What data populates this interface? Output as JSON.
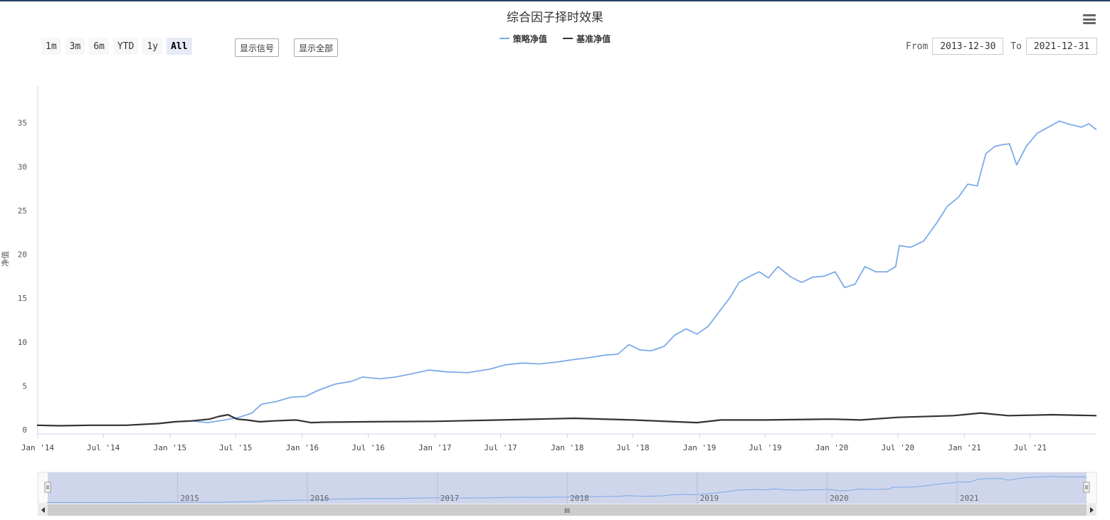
{
  "chart_data": {
    "type": "line",
    "title": "综合因子择时效果",
    "ylabel": "净值",
    "xlabel": "",
    "ylim": [
      0,
      40
    ],
    "yticks": [
      0,
      5,
      10,
      15,
      20,
      25,
      30,
      35
    ],
    "xlim": [
      "2014-01-01",
      "2021-12-31"
    ],
    "xticks": [
      {
        "date": "2014-01-01",
        "label": "Jan '14"
      },
      {
        "date": "2014-07-01",
        "label": "Jul '14"
      },
      {
        "date": "2015-01-01",
        "label": "Jan '15"
      },
      {
        "date": "2015-07-01",
        "label": "Jul '15"
      },
      {
        "date": "2016-01-01",
        "label": "Jan '16"
      },
      {
        "date": "2016-07-01",
        "label": "Jul '16"
      },
      {
        "date": "2017-01-01",
        "label": "Jan '17"
      },
      {
        "date": "2017-07-01",
        "label": "Jul '17"
      },
      {
        "date": "2018-01-01",
        "label": "Jan '18"
      },
      {
        "date": "2018-07-01",
        "label": "Jul '18"
      },
      {
        "date": "2019-01-01",
        "label": "Jan '19"
      },
      {
        "date": "2019-07-01",
        "label": "Jul '19"
      },
      {
        "date": "2020-01-01",
        "label": "Jan '20"
      },
      {
        "date": "2020-07-01",
        "label": "Jul '20"
      },
      {
        "date": "2021-01-01",
        "label": "Jan '21"
      },
      {
        "date": "2021-07-01",
        "label": "Jul '21"
      }
    ],
    "legend_position": "top-center",
    "grid": false,
    "series": [
      {
        "name": "策略净值",
        "color": "#7cabe8",
        "points": [
          [
            "2013-12-30",
            0.5
          ],
          [
            "2014-03-01",
            0.45
          ],
          [
            "2014-06-01",
            0.5
          ],
          [
            "2014-09-01",
            0.5
          ],
          [
            "2014-12-01",
            0.7
          ],
          [
            "2015-01-15",
            0.9
          ],
          [
            "2015-03-01",
            1.0
          ],
          [
            "2015-04-15",
            0.8
          ],
          [
            "2015-06-01",
            1.1
          ],
          [
            "2015-07-10",
            1.4
          ],
          [
            "2015-08-15",
            1.9
          ],
          [
            "2015-09-10",
            2.9
          ],
          [
            "2015-10-20",
            3.2
          ],
          [
            "2015-12-01",
            3.7
          ],
          [
            "2016-01-10",
            3.8
          ],
          [
            "2016-02-15",
            4.5
          ],
          [
            "2016-04-01",
            5.2
          ],
          [
            "2016-05-15",
            5.5
          ],
          [
            "2016-06-15",
            6.0
          ],
          [
            "2016-08-01",
            5.8
          ],
          [
            "2016-09-15",
            6.0
          ],
          [
            "2016-11-01",
            6.4
          ],
          [
            "2016-12-15",
            6.8
          ],
          [
            "2017-02-01",
            6.6
          ],
          [
            "2017-04-01",
            6.5
          ],
          [
            "2017-06-01",
            6.9
          ],
          [
            "2017-07-15",
            7.4
          ],
          [
            "2017-09-01",
            7.6
          ],
          [
            "2017-10-15",
            7.5
          ],
          [
            "2017-12-01",
            7.7
          ],
          [
            "2018-01-20",
            8.0
          ],
          [
            "2018-03-01",
            8.2
          ],
          [
            "2018-04-15",
            8.5
          ],
          [
            "2018-05-20",
            8.6
          ],
          [
            "2018-06-20",
            9.7
          ],
          [
            "2018-07-20",
            9.1
          ],
          [
            "2018-08-20",
            9.0
          ],
          [
            "2018-09-25",
            9.5
          ],
          [
            "2018-10-25",
            10.8
          ],
          [
            "2018-11-25",
            11.5
          ],
          [
            "2018-12-25",
            10.9
          ],
          [
            "2019-01-25",
            11.8
          ],
          [
            "2019-02-25",
            13.5
          ],
          [
            "2019-03-25",
            15.0
          ],
          [
            "2019-04-20",
            16.8
          ],
          [
            "2019-05-20",
            17.5
          ],
          [
            "2019-06-15",
            18.0
          ],
          [
            "2019-07-10",
            17.3
          ],
          [
            "2019-08-05",
            18.6
          ],
          [
            "2019-09-10",
            17.4
          ],
          [
            "2019-10-10",
            16.8
          ],
          [
            "2019-11-10",
            17.4
          ],
          [
            "2019-12-10",
            17.5
          ],
          [
            "2020-01-10",
            18.0
          ],
          [
            "2020-02-05",
            16.2
          ],
          [
            "2020-03-05",
            16.6
          ],
          [
            "2020-04-01",
            18.6
          ],
          [
            "2020-05-01",
            18.0
          ],
          [
            "2020-06-01",
            18.0
          ],
          [
            "2020-06-25",
            18.6
          ],
          [
            "2020-07-05",
            21.0
          ],
          [
            "2020-08-05",
            20.8
          ],
          [
            "2020-09-10",
            21.5
          ],
          [
            "2020-10-15",
            23.5
          ],
          [
            "2020-11-15",
            25.5
          ],
          [
            "2020-12-15",
            26.5
          ],
          [
            "2021-01-10",
            28.0
          ],
          [
            "2021-02-05",
            27.8
          ],
          [
            "2021-03-01",
            31.5
          ],
          [
            "2021-03-25",
            32.3
          ],
          [
            "2021-04-15",
            32.5
          ],
          [
            "2021-05-05",
            32.6
          ],
          [
            "2021-05-25",
            30.2
          ],
          [
            "2021-06-20",
            32.3
          ],
          [
            "2021-07-20",
            33.8
          ],
          [
            "2021-08-20",
            34.5
          ],
          [
            "2021-09-20",
            35.2
          ],
          [
            "2021-10-20",
            34.8
          ],
          [
            "2021-11-20",
            34.5
          ],
          [
            "2021-12-10",
            34.9
          ],
          [
            "2021-12-31",
            34.2
          ]
        ]
      },
      {
        "name": "基准净值",
        "color": "#333333",
        "points": [
          [
            "2013-12-30",
            0.5
          ],
          [
            "2014-03-01",
            0.45
          ],
          [
            "2014-06-01",
            0.5
          ],
          [
            "2014-09-01",
            0.5
          ],
          [
            "2014-12-01",
            0.7
          ],
          [
            "2015-01-15",
            0.9
          ],
          [
            "2015-03-01",
            1.0
          ],
          [
            "2015-04-20",
            1.2
          ],
          [
            "2015-05-15",
            1.5
          ],
          [
            "2015-06-10",
            1.7
          ],
          [
            "2015-07-05",
            1.2
          ],
          [
            "2015-08-01",
            1.1
          ],
          [
            "2015-09-05",
            0.9
          ],
          [
            "2015-10-15",
            1.0
          ],
          [
            "2015-12-15",
            1.1
          ],
          [
            "2016-01-25",
            0.8
          ],
          [
            "2016-03-01",
            0.85
          ],
          [
            "2016-07-01",
            0.9
          ],
          [
            "2017-01-01",
            0.95
          ],
          [
            "2017-07-01",
            1.1
          ],
          [
            "2018-01-20",
            1.3
          ],
          [
            "2018-07-01",
            1.1
          ],
          [
            "2018-12-25",
            0.8
          ],
          [
            "2019-03-01",
            1.1
          ],
          [
            "2019-07-01",
            1.1
          ],
          [
            "2020-01-01",
            1.2
          ],
          [
            "2020-03-20",
            1.1
          ],
          [
            "2020-07-01",
            1.4
          ],
          [
            "2020-12-01",
            1.6
          ],
          [
            "2021-02-15",
            1.9
          ],
          [
            "2021-05-01",
            1.6
          ],
          [
            "2021-09-01",
            1.7
          ],
          [
            "2021-12-31",
            1.6
          ]
        ]
      }
    ],
    "navigator": {
      "year_labels": [
        "2015",
        "2016",
        "2017",
        "2018",
        "2019",
        "2020",
        "2021"
      ],
      "scrollbar_grip": "III"
    }
  },
  "range_selector": {
    "buttons": [
      "1m",
      "3m",
      "6m",
      "YTD",
      "1y",
      "All"
    ],
    "selected": "All"
  },
  "signal_buttons": {
    "show_signal": "显示信号",
    "show_all": "显示全部"
  },
  "date_range": {
    "from_label": "From",
    "from_value": "2013-12-30",
    "to_label": "To",
    "to_value": "2021-12-31"
  },
  "icons": {
    "menu": "hamburger-menu-icon"
  }
}
